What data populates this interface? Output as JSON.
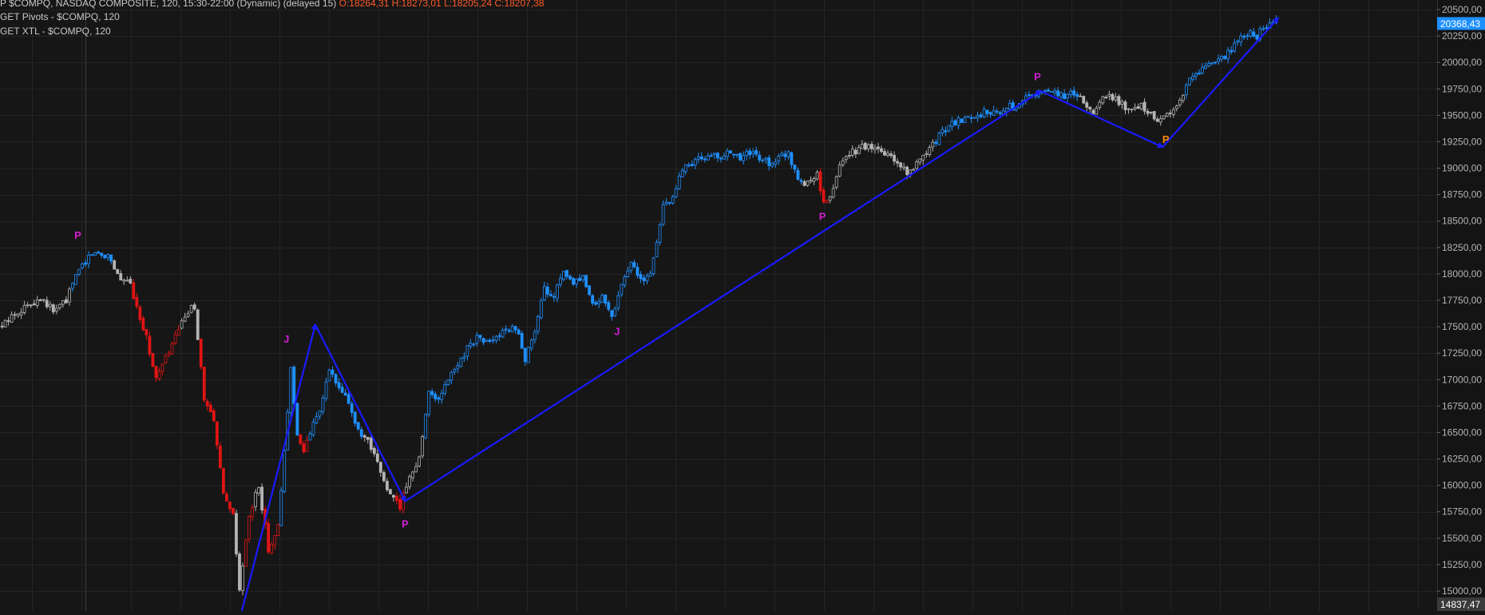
{
  "header": {
    "symbol_line": "P $COMPQ, NASDAQ COMPOSITE, 120, 15:30-22:00 (Dynamic) (delayed 15)",
    "ohlc": "O:18264,31 H:18273,01 L:18205,24 C:18207,38",
    "study1": "GET Pivots - $COMPQ, 120",
    "study2": "GET XTL - $COMPQ, 120"
  },
  "colors": {
    "background": "#161616",
    "grid": "#242424",
    "up_blue": "#1e90ff",
    "neutral_gray": "#b4b4b4",
    "down_red": "#e01414",
    "trend_line": "#1a1aff",
    "pivot_magenta": "#d21ed2",
    "pivot_orange": "#ff8c00",
    "last_price_box": "#1e90ff",
    "axis_text": "#b4b4b4"
  },
  "chart_data": {
    "type": "candlestick",
    "ylim": [
      14837.47,
      20500
    ],
    "y_ticks": [
      "20500,00",
      "20250,00",
      "20000,00",
      "19750,00",
      "19500,00",
      "19250,00",
      "19000,00",
      "18750,00",
      "18500,00",
      "18250,00",
      "18000,00",
      "17750,00",
      "17500,00",
      "17250,00",
      "17000,00",
      "16750,00",
      "16500,00",
      "16250,00",
      "16000,00",
      "15750,00",
      "15500,00",
      "15250,00",
      "15000,00"
    ],
    "last_price": "20368,43",
    "bottom_price": "14837,47",
    "price_path": [
      {
        "bar": 0,
        "v": 17500,
        "c": "n"
      },
      {
        "bar": 4,
        "v": 17630,
        "c": "n"
      },
      {
        "bar": 8,
        "v": 17700,
        "c": "n"
      },
      {
        "bar": 12,
        "v": 17780,
        "c": "n"
      },
      {
        "bar": 16,
        "v": 17650,
        "c": "n"
      },
      {
        "bar": 20,
        "v": 17750,
        "c": "n"
      },
      {
        "bar": 24,
        "v": 18050,
        "c": "u"
      },
      {
        "bar": 28,
        "v": 18200,
        "c": "u"
      },
      {
        "bar": 33,
        "v": 18180,
        "c": "u"
      },
      {
        "bar": 37,
        "v": 17950,
        "c": "n"
      },
      {
        "bar": 40,
        "v": 17900,
        "c": "n"
      },
      {
        "bar": 42,
        "v": 17700,
        "c": "d"
      },
      {
        "bar": 45,
        "v": 17400,
        "c": "d"
      },
      {
        "bar": 48,
        "v": 17000,
        "c": "d"
      },
      {
        "bar": 51,
        "v": 17200,
        "c": "d"
      },
      {
        "bar": 54,
        "v": 17400,
        "c": "d"
      },
      {
        "bar": 57,
        "v": 17600,
        "c": "n"
      },
      {
        "bar": 60,
        "v": 17700,
        "c": "n"
      },
      {
        "bar": 63,
        "v": 16800,
        "c": "d"
      },
      {
        "bar": 66,
        "v": 16600,
        "c": "d"
      },
      {
        "bar": 69,
        "v": 15900,
        "c": "d"
      },
      {
        "bar": 72,
        "v": 15700,
        "c": "d"
      },
      {
        "bar": 74,
        "v": 15000,
        "c": "n"
      },
      {
        "bar": 77,
        "v": 15700,
        "c": "d"
      },
      {
        "bar": 80,
        "v": 16000,
        "c": "n"
      },
      {
        "bar": 83,
        "v": 15400,
        "c": "d"
      },
      {
        "bar": 86,
        "v": 15600,
        "c": "d"
      },
      {
        "bar": 88,
        "v": 16300,
        "c": "u"
      },
      {
        "bar": 90,
        "v": 17100,
        "c": "u"
      },
      {
        "bar": 92,
        "v": 16500,
        "c": "u"
      },
      {
        "bar": 94,
        "v": 16300,
        "c": "d"
      },
      {
        "bar": 97,
        "v": 16600,
        "c": "u"
      },
      {
        "bar": 100,
        "v": 16800,
        "c": "u"
      },
      {
        "bar": 102,
        "v": 17100,
        "c": "u"
      },
      {
        "bar": 105,
        "v": 16900,
        "c": "u"
      },
      {
        "bar": 108,
        "v": 16800,
        "c": "u"
      },
      {
        "bar": 111,
        "v": 16500,
        "c": "u"
      },
      {
        "bar": 114,
        "v": 16400,
        "c": "n"
      },
      {
        "bar": 117,
        "v": 16200,
        "c": "n"
      },
      {
        "bar": 121,
        "v": 15900,
        "c": "n"
      },
      {
        "bar": 124,
        "v": 15800,
        "c": "d"
      },
      {
        "bar": 127,
        "v": 16100,
        "c": "n"
      },
      {
        "bar": 130,
        "v": 16250,
        "c": "n"
      },
      {
        "bar": 133,
        "v": 16900,
        "c": "u"
      },
      {
        "bar": 136,
        "v": 16800,
        "c": "u"
      },
      {
        "bar": 139,
        "v": 17000,
        "c": "u"
      },
      {
        "bar": 142,
        "v": 17150,
        "c": "u"
      },
      {
        "bar": 145,
        "v": 17300,
        "c": "u"
      },
      {
        "bar": 148,
        "v": 17400,
        "c": "u"
      },
      {
        "bar": 151,
        "v": 17350,
        "c": "u"
      },
      {
        "bar": 154,
        "v": 17400,
        "c": "u"
      },
      {
        "bar": 157,
        "v": 17450,
        "c": "u"
      },
      {
        "bar": 160,
        "v": 17500,
        "c": "u"
      },
      {
        "bar": 163,
        "v": 17200,
        "c": "u"
      },
      {
        "bar": 166,
        "v": 17450,
        "c": "u"
      },
      {
        "bar": 169,
        "v": 17850,
        "c": "u"
      },
      {
        "bar": 172,
        "v": 17800,
        "c": "u"
      },
      {
        "bar": 175,
        "v": 18000,
        "c": "u"
      },
      {
        "bar": 178,
        "v": 17900,
        "c": "u"
      },
      {
        "bar": 181,
        "v": 17950,
        "c": "u"
      },
      {
        "bar": 184,
        "v": 17700,
        "c": "u"
      },
      {
        "bar": 187,
        "v": 17780,
        "c": "u"
      },
      {
        "bar": 190,
        "v": 17600,
        "c": "u"
      },
      {
        "bar": 193,
        "v": 17900,
        "c": "u"
      },
      {
        "bar": 196,
        "v": 18100,
        "c": "u"
      },
      {
        "bar": 199,
        "v": 17950,
        "c": "u"
      },
      {
        "bar": 202,
        "v": 17980,
        "c": "u"
      },
      {
        "bar": 206,
        "v": 18650,
        "c": "u"
      },
      {
        "bar": 209,
        "v": 18700,
        "c": "u"
      },
      {
        "bar": 212,
        "v": 19000,
        "c": "u"
      },
      {
        "bar": 215,
        "v": 19050,
        "c": "u"
      },
      {
        "bar": 218,
        "v": 19100,
        "c": "u"
      },
      {
        "bar": 221,
        "v": 19120,
        "c": "u"
      },
      {
        "bar": 224,
        "v": 19100,
        "c": "u"
      },
      {
        "bar": 227,
        "v": 19150,
        "c": "u"
      },
      {
        "bar": 230,
        "v": 19080,
        "c": "u"
      },
      {
        "bar": 233,
        "v": 19150,
        "c": "u"
      },
      {
        "bar": 236,
        "v": 19100,
        "c": "u"
      },
      {
        "bar": 239,
        "v": 19050,
        "c": "u"
      },
      {
        "bar": 242,
        "v": 19100,
        "c": "u"
      },
      {
        "bar": 245,
        "v": 19150,
        "c": "u"
      },
      {
        "bar": 248,
        "v": 18900,
        "c": "u"
      },
      {
        "bar": 251,
        "v": 18850,
        "c": "n"
      },
      {
        "bar": 254,
        "v": 18950,
        "c": "n"
      },
      {
        "bar": 256,
        "v": 18650,
        "c": "d"
      },
      {
        "bar": 259,
        "v": 18800,
        "c": "n"
      },
      {
        "bar": 262,
        "v": 19100,
        "c": "n"
      },
      {
        "bar": 265,
        "v": 19150,
        "c": "n"
      },
      {
        "bar": 268,
        "v": 19200,
        "c": "n"
      },
      {
        "bar": 271,
        "v": 19180,
        "c": "n"
      },
      {
        "bar": 274,
        "v": 19150,
        "c": "n"
      },
      {
        "bar": 277,
        "v": 19100,
        "c": "n"
      },
      {
        "bar": 280,
        "v": 19000,
        "c": "n"
      },
      {
        "bar": 283,
        "v": 18950,
        "c": "n"
      },
      {
        "bar": 286,
        "v": 19100,
        "c": "n"
      },
      {
        "bar": 289,
        "v": 19200,
        "c": "n"
      },
      {
        "bar": 292,
        "v": 19300,
        "c": "u"
      },
      {
        "bar": 295,
        "v": 19400,
        "c": "u"
      },
      {
        "bar": 298,
        "v": 19450,
        "c": "u"
      },
      {
        "bar": 301,
        "v": 19480,
        "c": "u"
      },
      {
        "bar": 304,
        "v": 19500,
        "c": "u"
      },
      {
        "bar": 307,
        "v": 19550,
        "c": "u"
      },
      {
        "bar": 310,
        "v": 19500,
        "c": "u"
      },
      {
        "bar": 313,
        "v": 19600,
        "c": "u"
      },
      {
        "bar": 316,
        "v": 19550,
        "c": "u"
      },
      {
        "bar": 319,
        "v": 19650,
        "c": "u"
      },
      {
        "bar": 322,
        "v": 19700,
        "c": "u"
      },
      {
        "bar": 325,
        "v": 19750,
        "c": "u"
      },
      {
        "bar": 328,
        "v": 19720,
        "c": "u"
      },
      {
        "bar": 331,
        "v": 19680,
        "c": "u"
      },
      {
        "bar": 334,
        "v": 19700,
        "c": "u"
      },
      {
        "bar": 337,
        "v": 19650,
        "c": "n"
      },
      {
        "bar": 340,
        "v": 19500,
        "c": "n"
      },
      {
        "bar": 343,
        "v": 19700,
        "c": "n"
      },
      {
        "bar": 346,
        "v": 19680,
        "c": "n"
      },
      {
        "bar": 349,
        "v": 19600,
        "c": "n"
      },
      {
        "bar": 352,
        "v": 19550,
        "c": "n"
      },
      {
        "bar": 355,
        "v": 19600,
        "c": "n"
      },
      {
        "bar": 358,
        "v": 19500,
        "c": "n"
      },
      {
        "bar": 361,
        "v": 19450,
        "c": "n"
      },
      {
        "bar": 364,
        "v": 19550,
        "c": "n"
      },
      {
        "bar": 367,
        "v": 19650,
        "c": "n"
      },
      {
        "bar": 370,
        "v": 19850,
        "c": "u"
      },
      {
        "bar": 373,
        "v": 19920,
        "c": "u"
      },
      {
        "bar": 376,
        "v": 19980,
        "c": "u"
      },
      {
        "bar": 379,
        "v": 20000,
        "c": "u"
      },
      {
        "bar": 382,
        "v": 20100,
        "c": "u"
      },
      {
        "bar": 385,
        "v": 20200,
        "c": "u"
      },
      {
        "bar": 388,
        "v": 20280,
        "c": "u"
      },
      {
        "bar": 391,
        "v": 20250,
        "c": "u"
      },
      {
        "bar": 394,
        "v": 20350,
        "c": "u"
      },
      {
        "bar": 397,
        "v": 20380,
        "c": "u"
      }
    ],
    "trend_lines": [
      {
        "from": {
          "bar": 75,
          "v": 14800
        },
        "to": {
          "bar": 98,
          "v": 17520
        }
      },
      {
        "from": {
          "bar": 98,
          "v": 17520
        },
        "to": {
          "bar": 126,
          "v": 15850
        }
      },
      {
        "from": {
          "bar": 126,
          "v": 15850
        },
        "to": {
          "bar": 324,
          "v": 19730
        }
      },
      {
        "from": {
          "bar": 324,
          "v": 19730
        },
        "to": {
          "bar": 362,
          "v": 19200
        }
      },
      {
        "from": {
          "bar": 362,
          "v": 19200
        },
        "to": {
          "bar": 398,
          "v": 20420
        }
      }
    ],
    "pivot_labels": [
      {
        "text": "P",
        "bar": 24,
        "v": 18330,
        "color": "magenta"
      },
      {
        "text": "J",
        "bar": 89,
        "v": 17350,
        "color": "magenta"
      },
      {
        "text": "P",
        "bar": 126,
        "v": 15600,
        "color": "magenta"
      },
      {
        "text": "J",
        "bar": 192,
        "v": 17420,
        "color": "magenta"
      },
      {
        "text": "P",
        "bar": 256,
        "v": 18510,
        "color": "magenta"
      },
      {
        "text": "P",
        "bar": 323,
        "v": 19830,
        "color": "magenta"
      },
      {
        "text": "P",
        "bar": 363,
        "v": 19240,
        "color": "orange"
      }
    ]
  }
}
